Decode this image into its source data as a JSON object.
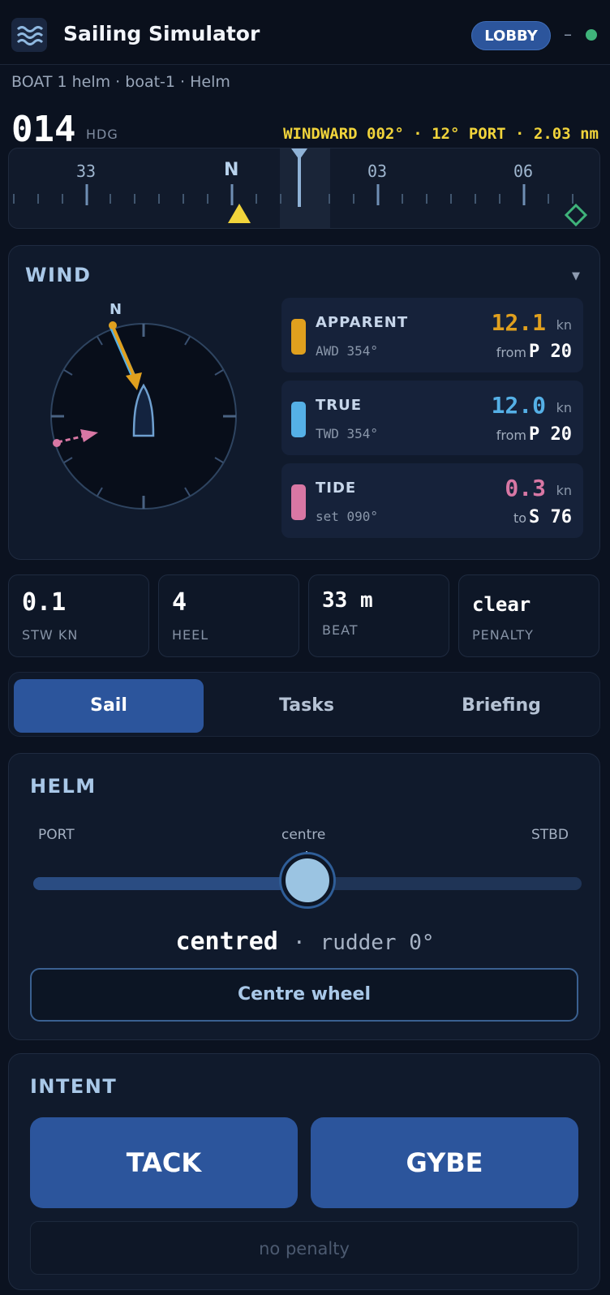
{
  "header": {
    "app_title": "Sailing Simulator",
    "lobby_label": "LOBBY",
    "separator": "–",
    "status_color": "#3fb37a"
  },
  "subheader": "BOAT 1 helm · boat-1 · Helm",
  "heading": {
    "value": "014",
    "label": "HDG",
    "windward": "WINDWARD 002° · 12° PORT · 2.03 nm"
  },
  "compass_strip": {
    "labels": [
      "33",
      "N",
      "03",
      "06"
    ]
  },
  "wind": {
    "title": "WIND",
    "dial_north": "N",
    "rows": [
      {
        "name": "APPARENT",
        "sub": "AWD 354°",
        "value": "12.1",
        "unit": "kn",
        "prefix": "from",
        "dir": "P 20",
        "color": "#e0a01e"
      },
      {
        "name": "TRUE",
        "sub": "TWD 354°",
        "value": "12.0",
        "unit": "kn",
        "prefix": "from",
        "dir": "P 20",
        "color": "#55b0e6"
      },
      {
        "name": "TIDE",
        "sub": "set 090°",
        "value": "0.3",
        "unit": "kn",
        "prefix": "to",
        "dir": "S 76",
        "color": "#d877a4"
      }
    ]
  },
  "stats": [
    {
      "value": "0.1",
      "label": "STW KN"
    },
    {
      "value": "4",
      "label": "HEEL"
    },
    {
      "value": "33 m",
      "label": "BEAT"
    },
    {
      "value": "clear",
      "label": "PENALTY"
    }
  ],
  "tabs": [
    {
      "label": "Sail",
      "active": true
    },
    {
      "label": "Tasks",
      "active": false
    },
    {
      "label": "Briefing",
      "active": false
    }
  ],
  "helm": {
    "title": "HELM",
    "left_label": "PORT",
    "center_label": "centre",
    "right_label": "STBD",
    "position": 0.5,
    "state": "centred",
    "separator": "·",
    "rudder": "rudder 0°",
    "centre_button": "Centre wheel"
  },
  "intent": {
    "title": "INTENT",
    "tack_label": "TACK",
    "gybe_label": "GYBE",
    "penalty_text": "no penalty"
  }
}
